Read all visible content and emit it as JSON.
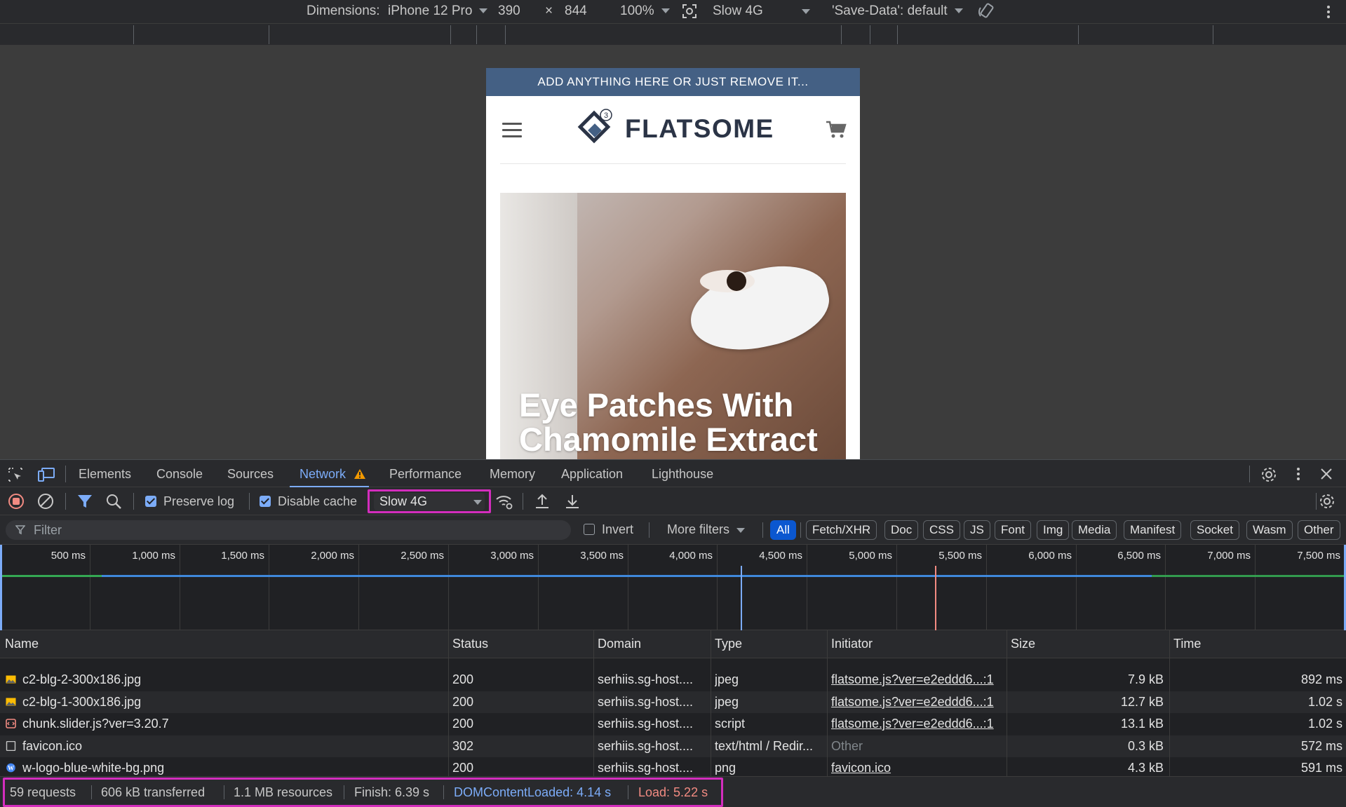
{
  "device_toolbar": {
    "dimensions_label": "Dimensions:",
    "device": "iPhone 12 Pro",
    "width": "390",
    "times": "×",
    "height": "844",
    "zoom": "100%",
    "throttle": "Slow 4G",
    "save_data": "'Save-Data': default"
  },
  "preview": {
    "top_bar_text": "ADD ANYTHING HERE OR JUST REMOVE IT...",
    "logo_text": "FLATSOME",
    "logo_badge": "3",
    "hero_title_line1": "Eye Patches With",
    "hero_title_line2": "Chamomile Extract"
  },
  "devtools": {
    "tabs": [
      "Elements",
      "Console",
      "Sources",
      "Network",
      "Performance",
      "Memory",
      "Application",
      "Lighthouse"
    ],
    "active_tab": "Network",
    "toolbar": {
      "preserve_log": "Preserve log",
      "disable_cache": "Disable cache",
      "throttle": "Slow 4G"
    },
    "filter": {
      "placeholder": "Filter",
      "invert": "Invert",
      "more_filters": "More filters",
      "chips": [
        "All",
        "Fetch/XHR",
        "Doc",
        "CSS",
        "JS",
        "Font",
        "Img",
        "Media",
        "Manifest",
        "Socket",
        "Wasm",
        "Other"
      ]
    },
    "timeline_ticks": [
      "500 ms",
      "1,000 ms",
      "1,500 ms",
      "2,000 ms",
      "2,500 ms",
      "3,000 ms",
      "3,500 ms",
      "4,000 ms",
      "4,500 ms",
      "5,000 ms",
      "5,500 ms",
      "6,000 ms",
      "6,500 ms",
      "7,000 ms",
      "7,500 ms"
    ],
    "columns": [
      "Name",
      "Status",
      "Domain",
      "Type",
      "Initiator",
      "Size",
      "Time"
    ],
    "rows": [
      {
        "name": "c2-blg-2-300x186.jpg",
        "status": "200",
        "domain": "serhiis.sg-host....",
        "type": "jpeg",
        "initiator": "flatsome.js?ver=e2eddd6...:1",
        "size": "7.9 kB",
        "time": "892 ms",
        "icon": "image-icon"
      },
      {
        "name": "c2-blg-1-300x186.jpg",
        "status": "200",
        "domain": "serhiis.sg-host....",
        "type": "jpeg",
        "initiator": "flatsome.js?ver=e2eddd6...:1",
        "size": "12.7 kB",
        "time": "1.02 s",
        "icon": "image-icon"
      },
      {
        "name": "chunk.slider.js?ver=3.20.7",
        "status": "200",
        "domain": "serhiis.sg-host....",
        "type": "script",
        "initiator": "flatsome.js?ver=e2eddd6...:1",
        "size": "13.1 kB",
        "time": "1.02 s",
        "icon": "script-icon"
      },
      {
        "name": "favicon.ico",
        "status": "302",
        "domain": "serhiis.sg-host....",
        "type": "text/html / Redir...",
        "initiator": "Other",
        "size": "0.3 kB",
        "time": "572 ms",
        "icon": "document-icon"
      },
      {
        "name": "w-logo-blue-white-bg.png",
        "status": "200",
        "domain": "serhiis.sg-host....",
        "type": "png",
        "initiator": "favicon.ico",
        "size": "4.3 kB",
        "time": "591 ms",
        "icon": "wordpress-icon"
      }
    ],
    "summary": {
      "requests": "59 requests",
      "transferred": "606 kB transferred",
      "resources": "1.1 MB resources",
      "finish": "Finish: 6.39 s",
      "dom_content_loaded": "DOMContentLoaded: 4.14 s",
      "load": "Load: 5.22 s"
    },
    "colors": {
      "accent": "#7cacf8",
      "highlight": "#d32dbd",
      "dcl": "#7cacf8",
      "load": "#f28b82",
      "warning": "#f29900"
    }
  }
}
